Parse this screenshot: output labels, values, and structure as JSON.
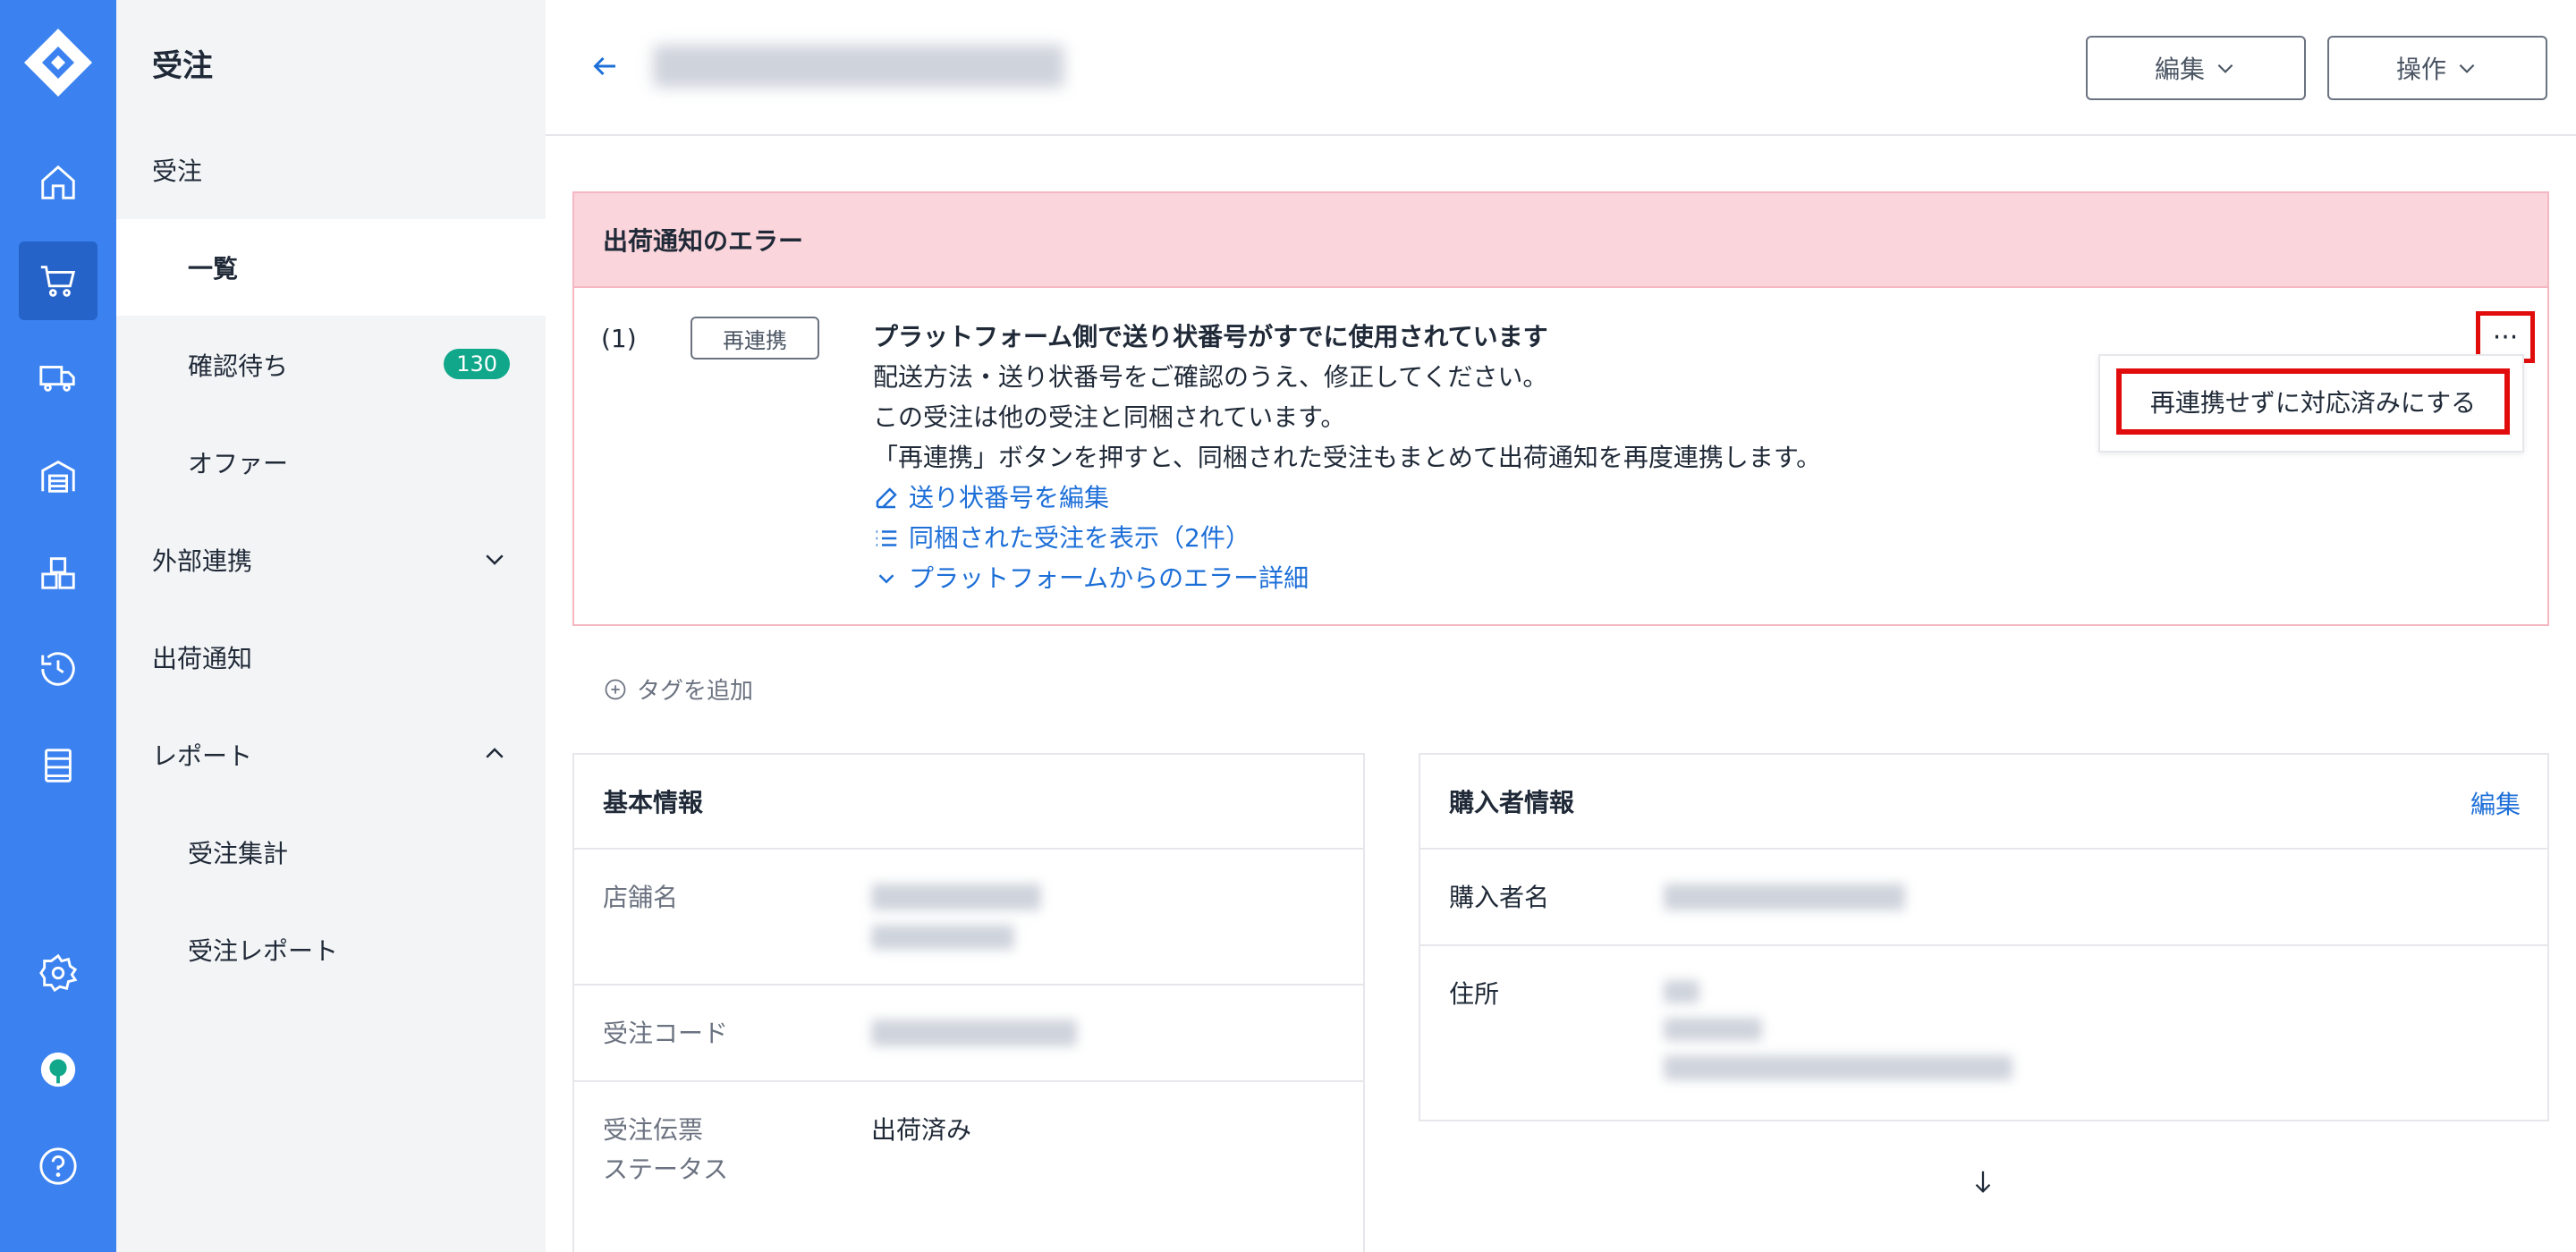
{
  "rail": {
    "icons": [
      "logo-icon",
      "home-icon",
      "cart-icon",
      "truck-icon",
      "warehouse-icon",
      "boxes-icon",
      "history-icon",
      "database-icon",
      "settings-icon",
      "status-icon",
      "help-icon"
    ],
    "active": "cart-icon",
    "color": "#3b82f0"
  },
  "sidebar": {
    "title": "受注",
    "items": [
      {
        "label": "受注"
      },
      {
        "label": "一覧"
      },
      {
        "label": "確認待ち",
        "badge": "130"
      },
      {
        "label": "オファー"
      },
      {
        "label": "外部連携"
      },
      {
        "label": "出荷通知"
      },
      {
        "label": "レポート"
      },
      {
        "label": "受注集計"
      },
      {
        "label": "受注レポート"
      }
    ]
  },
  "header": {
    "edit_label": "編集",
    "ops_label": "操作"
  },
  "error_panel": {
    "title": "出荷通知のエラー",
    "index": "(1)",
    "relink_tag": "再連携",
    "message_title": "プラットフォーム側で送り状番号がすでに使用されています",
    "line1": "配送方法・送り状番号をご確認のうえ、修正してください。",
    "line2": "この受注は他の受注と同梱されています。",
    "line3": "「再連携」ボタンを押すと、同梱された受注もまとめて出荷通知を再度連携します。",
    "link_edit": "送り状番号を編集",
    "link_bundled": "同梱された受注を表示（2件）",
    "link_details": "プラットフォームからのエラー詳細",
    "more_label": "···",
    "menu_item": "再連携せずに対応済みにする"
  },
  "add_tag": "タグを追加",
  "basic_info": {
    "title": "基本情報",
    "store_label": "店舗名",
    "code_label": "受注コード",
    "status_label_1": "受注伝票",
    "status_label_2": "ステータス",
    "status_value": "出荷済み"
  },
  "buyer_info": {
    "title": "購入者情報",
    "edit": "編集",
    "name_label": "購入者名",
    "address_label": "住所"
  },
  "colors": {
    "accent": "#3b82f0",
    "link": "#1d6fd8",
    "error_bg": "#fbd5dc",
    "highlight": "#e10d0d",
    "badge": "#10a78a"
  }
}
